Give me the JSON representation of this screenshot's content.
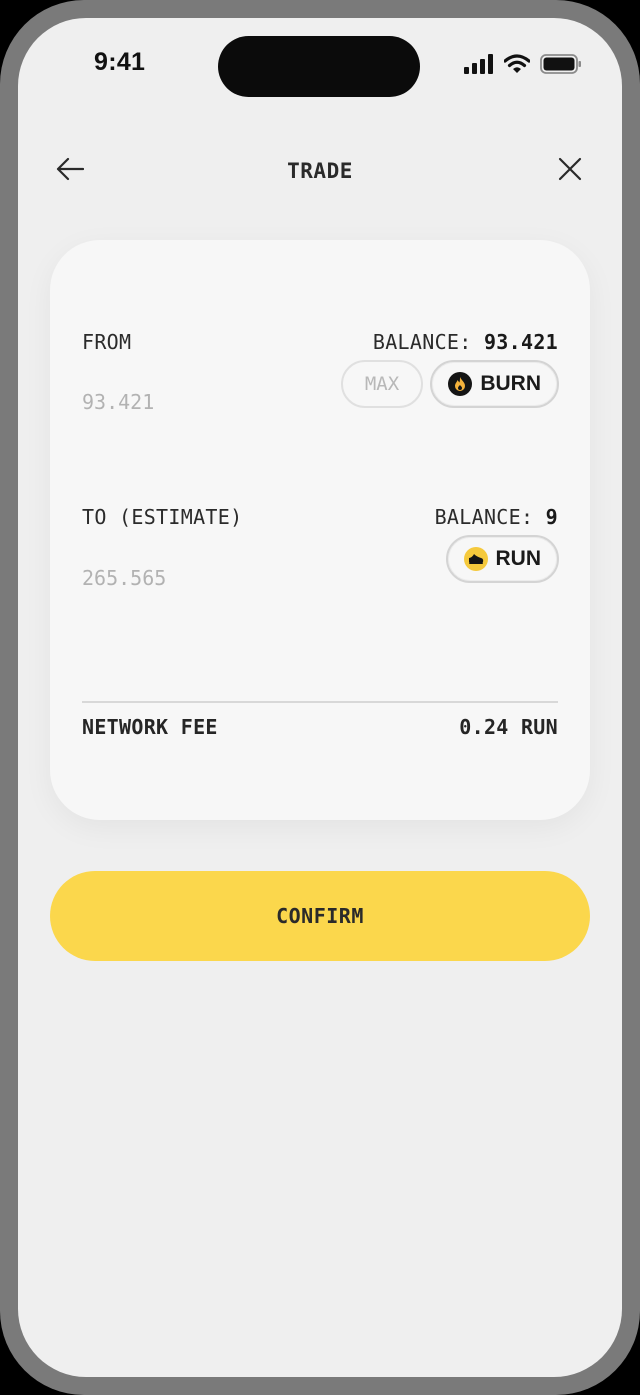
{
  "status_bar": {
    "time": "9:41"
  },
  "header": {
    "title": "TRADE",
    "back_icon": "arrow-left-icon",
    "close_icon": "close-icon"
  },
  "from": {
    "label": "FROM",
    "balance_label": "BALANCE:",
    "balance_value": "93.421",
    "amount_placeholder": "93.421",
    "max_label": "MAX",
    "token": {
      "name": "BURN",
      "icon": "flame-icon"
    }
  },
  "to": {
    "label": "TO (ESTIMATE)",
    "balance_label": "BALANCE:",
    "balance_value": "9",
    "amount_placeholder": "265.565",
    "token": {
      "name": "RUN",
      "icon": "sneaker-icon"
    }
  },
  "fee": {
    "label": "NETWORK FEE",
    "value": "0.24 RUN"
  },
  "confirm": {
    "label": "CONFIRM"
  },
  "colors": {
    "accent": "#fbd74c",
    "background": "#efefef",
    "card": "#f7f7f7",
    "muted_text": "#b2b2b2"
  }
}
